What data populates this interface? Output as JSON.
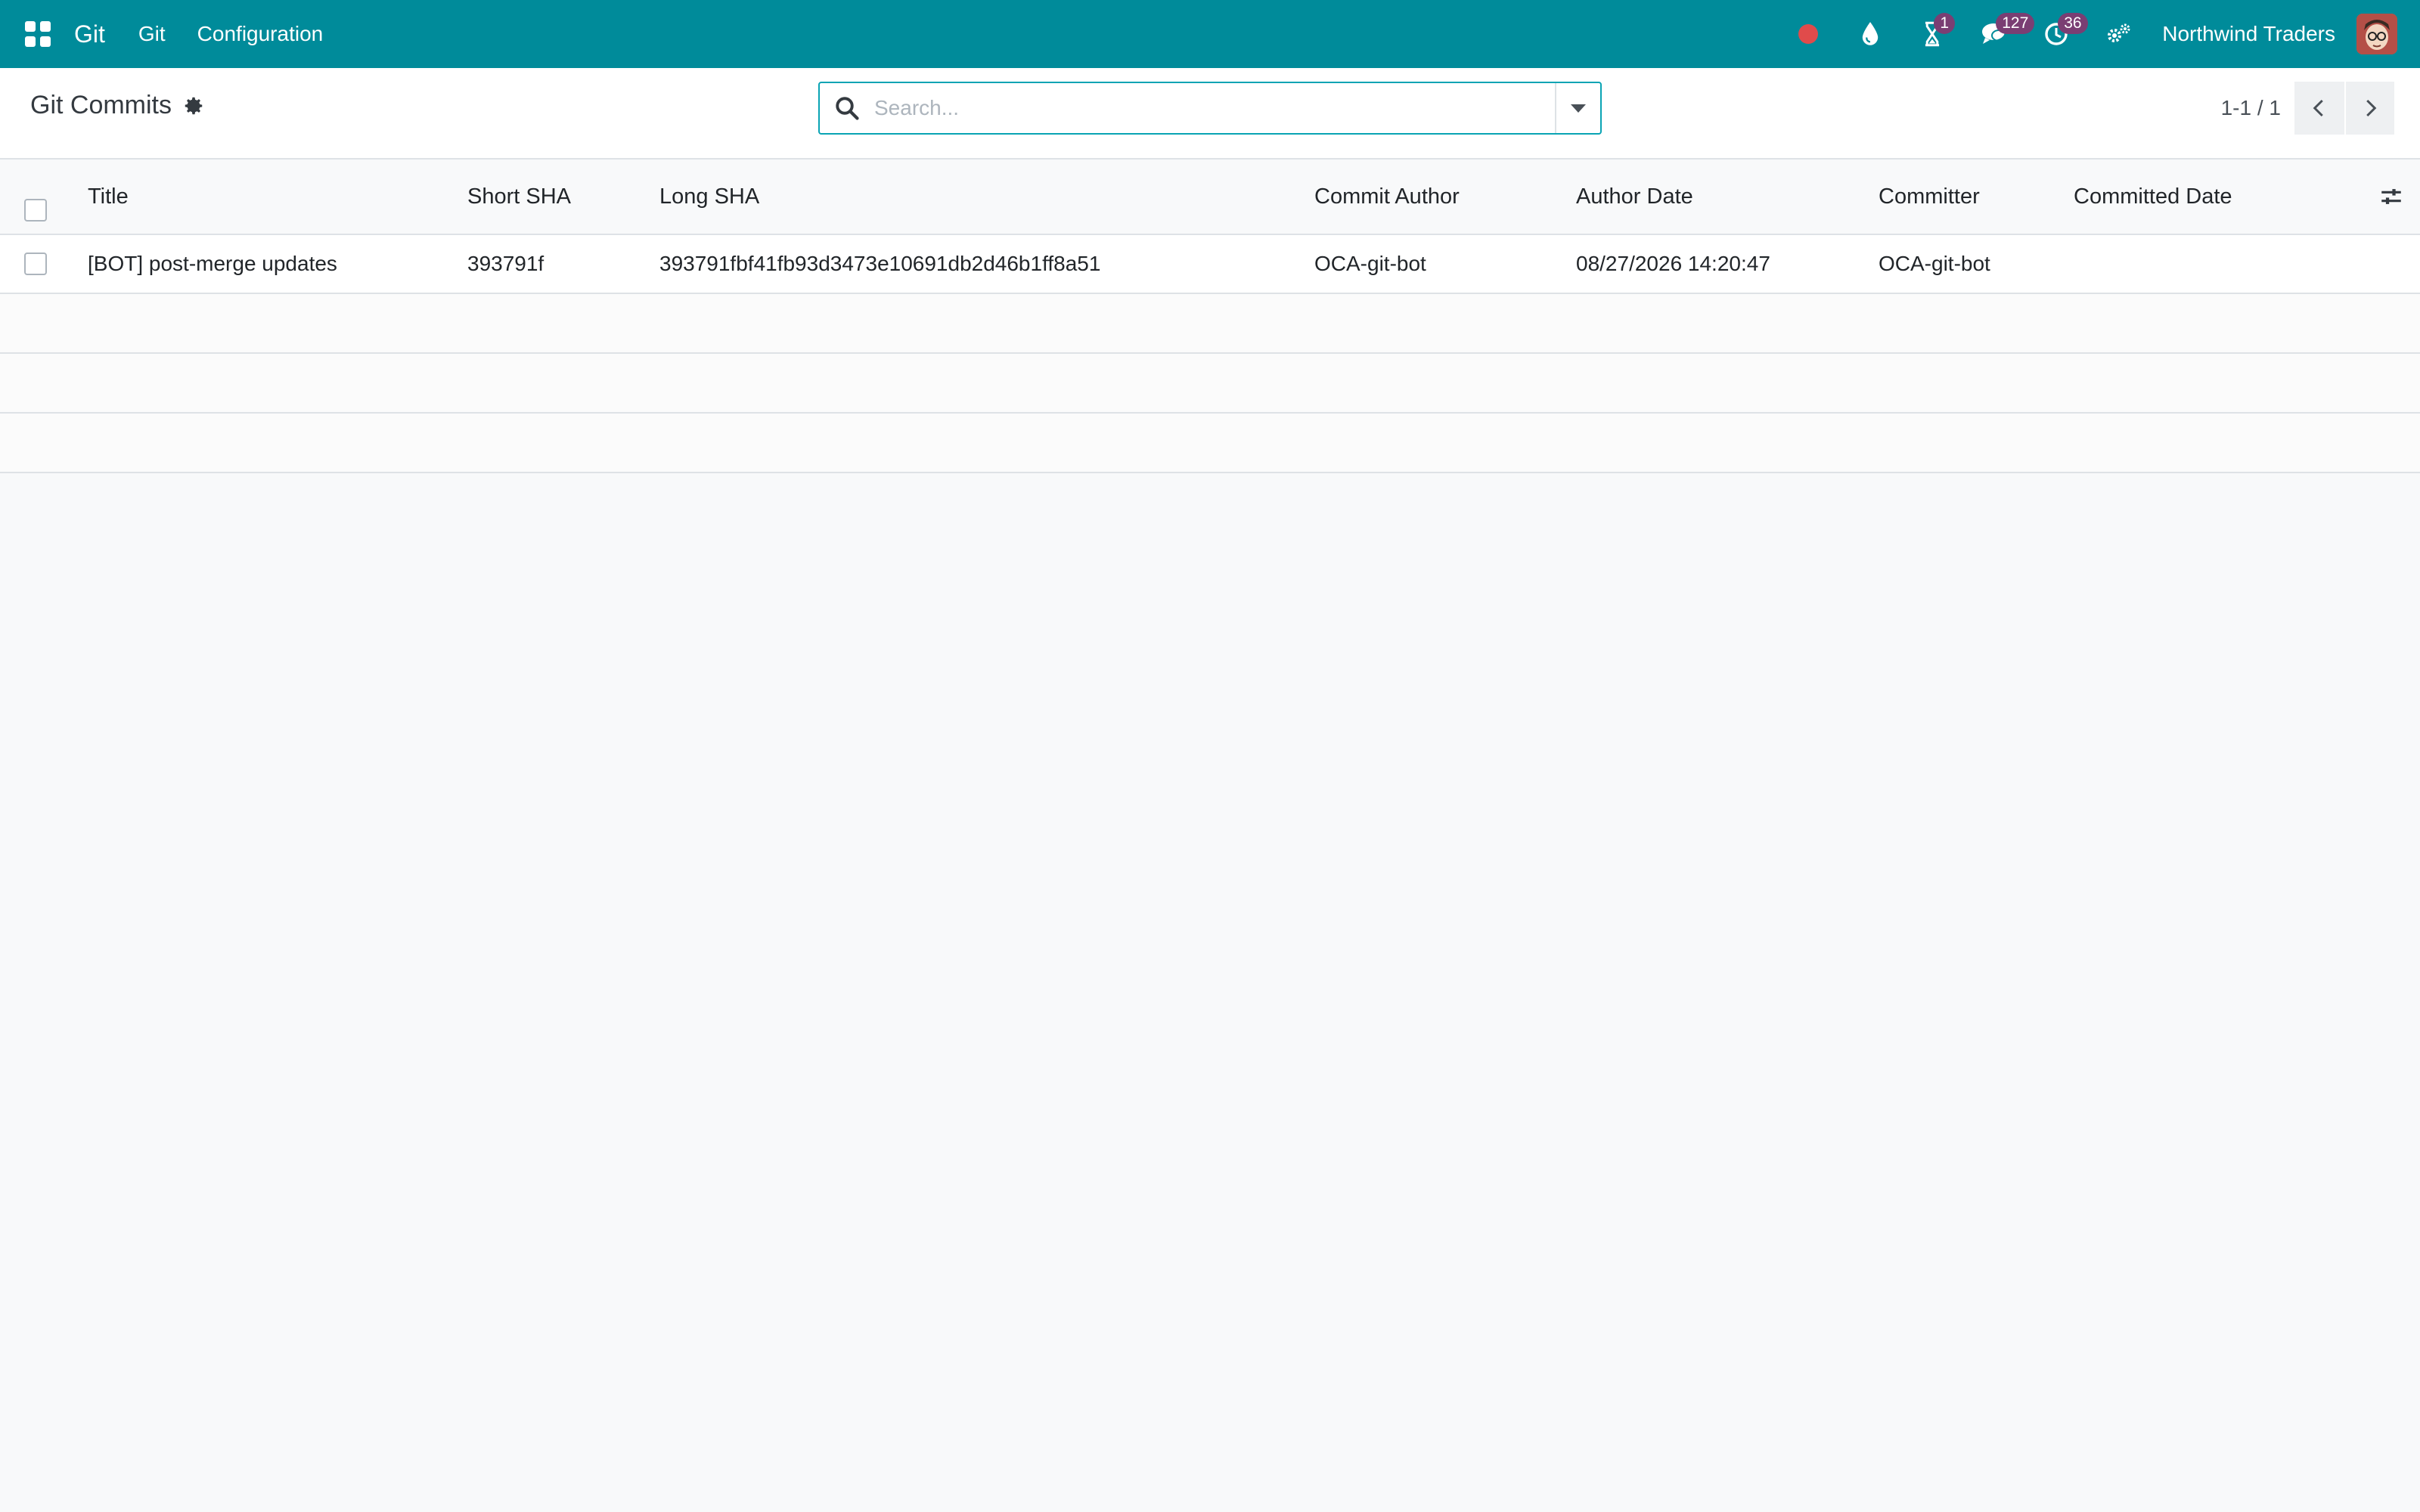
{
  "navbar": {
    "brand": "Git",
    "menus": [
      "Git",
      "Configuration"
    ],
    "badges": {
      "activities": "1",
      "messages": "127",
      "clock": "36"
    },
    "company": "Northwind Traders"
  },
  "control_panel": {
    "title": "Git Commits",
    "search_placeholder": "Search...",
    "pager": "1-1 / 1"
  },
  "table": {
    "columns": [
      "Title",
      "Short SHA",
      "Long SHA",
      "Commit Author",
      "Author Date",
      "Committer",
      "Committed Date"
    ],
    "rows": [
      {
        "title": "[BOT] post-merge updates",
        "short_sha": "393791f",
        "long_sha": "393791fbf41fb93d3473e10691db2d46b1ff8a51",
        "commit_author": "OCA-git-bot",
        "author_date": "08/27/2026 14:20:47",
        "committer": "OCA-git-bot",
        "committed_date": ""
      }
    ]
  },
  "colors": {
    "navbar": "#008b9a",
    "badge": "#7a3e73",
    "record": "#e04b4b",
    "search_border": "#0aa4b4"
  }
}
